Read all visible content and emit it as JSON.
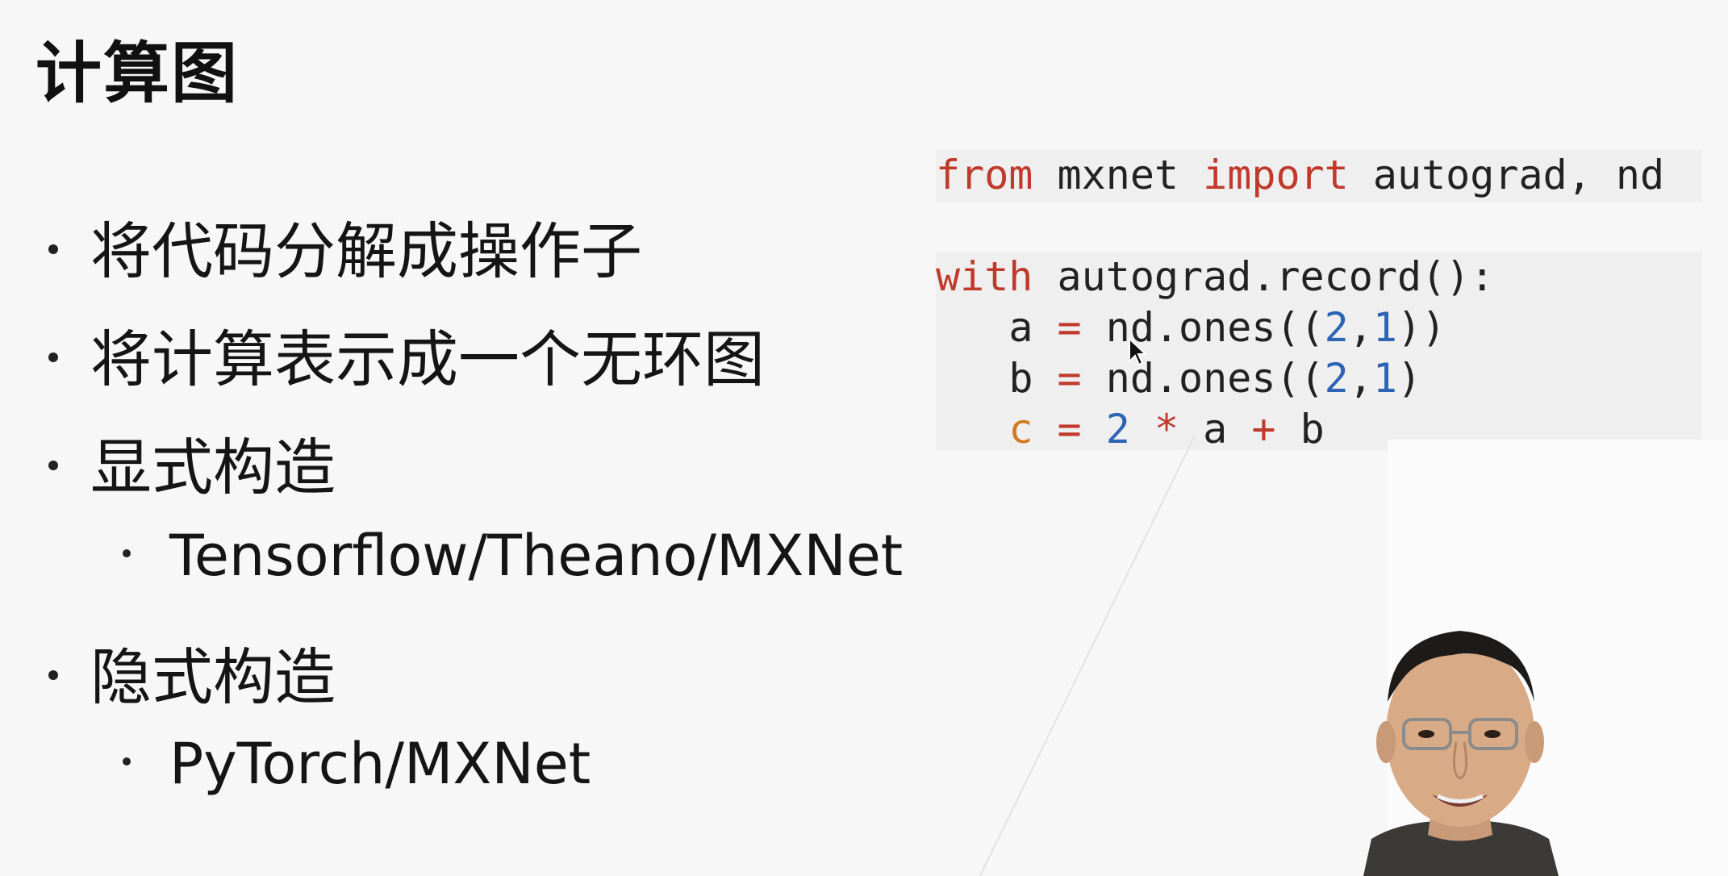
{
  "slide": {
    "title": "计算图",
    "bullets": [
      {
        "text": "将代码分解成操作子",
        "level": 1
      },
      {
        "text": "将计算表示成一个无环图",
        "level": 1
      },
      {
        "text": "显式构造",
        "level": 1
      },
      {
        "text": "Tensorflow/Theano/MXNet",
        "level": 2
      },
      {
        "text": "隐式构造",
        "level": 1
      },
      {
        "text": "PyTorch/MXNet",
        "level": 2
      }
    ]
  },
  "code": {
    "line1": {
      "kw1": "from",
      "mod": " mxnet ",
      "kw2": "import",
      "rest": " autograd, nd"
    },
    "line3": {
      "kw": "with",
      "rest": " autograd.record():"
    },
    "line4": {
      "indent": "   ",
      "var": "a",
      "eq": " = ",
      "call": "nd.ones((",
      "n1": "2",
      "comma": ",",
      "n2": "1",
      "close": "))"
    },
    "line5": {
      "indent": "   ",
      "var": "b",
      "eq": " = ",
      "call": "nd.ones((",
      "n1": "2",
      "comma": ",",
      "n2": "1",
      "close": ")"
    },
    "line6": {
      "indent": "   ",
      "var": "c",
      "eq": " = ",
      "n1": "2",
      "mul": " * ",
      "a": "a",
      "plus": " + ",
      "b": "b"
    }
  },
  "colors": {
    "keyword": "#c0392b",
    "number": "#2d64b3",
    "variable": "#d07a22",
    "background": "#f7f7f7"
  },
  "icons": {
    "cursor": "mouse-pointer-icon",
    "presenter": "presenter-video"
  }
}
